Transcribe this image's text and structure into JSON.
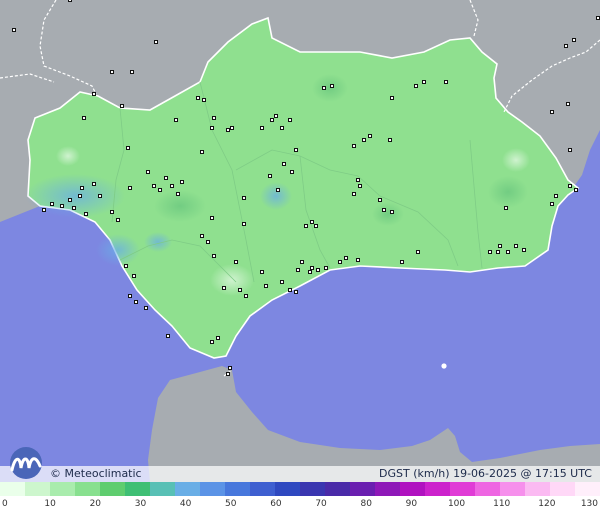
{
  "map": {
    "credit": "© Meteoclimatic",
    "title": "DGST (km/h)  19-06-2025 @ 17:15 UTC",
    "logo_icon": "meteoclimatic-logo-icon",
    "colors": {
      "sea": "#7d87e1",
      "land_outside": "#a7acb1",
      "region_fill": "#8fe08f",
      "region_stroke": "#ffffff",
      "station": "#111111"
    }
  },
  "legend": {
    "ticks": [
      "0",
      "10",
      "20",
      "30",
      "40",
      "50",
      "60",
      "70",
      "80",
      "90",
      "100",
      "110",
      "120",
      "130"
    ],
    "colors": [
      "#eaffea",
      "#cdf6cd",
      "#a9ecad",
      "#88e08f",
      "#5fcd6f",
      "#3fbf74",
      "#58c0b5",
      "#69aee6",
      "#5b93e6",
      "#4777dc",
      "#3e5fd0",
      "#2f49c0",
      "#3a36b0",
      "#4a2aa8",
      "#6a1fb0",
      "#8e18b8",
      "#b012c0",
      "#cc22cc",
      "#e03cd6",
      "#ee66e2",
      "#f690ec",
      "#fbbaf2",
      "#ffd8f7",
      "#ffeffb"
    ]
  }
}
